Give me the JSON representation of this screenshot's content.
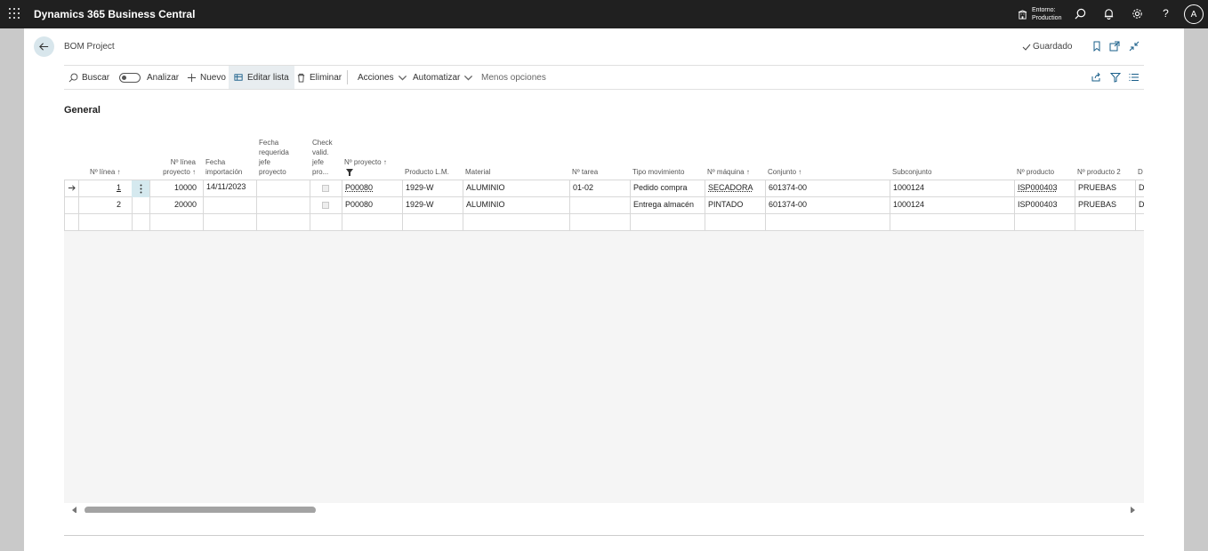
{
  "app": {
    "title": "Dynamics 365 Business Central",
    "env_label": "Entorno:",
    "env_value": "Production",
    "user_initial": "A"
  },
  "page": {
    "title": "BOM Project",
    "saved_label": "Guardado"
  },
  "actions": {
    "search": "Buscar",
    "analyze": "Analizar",
    "new": "Nuevo",
    "edit_list": "Editar lista",
    "delete": "Eliminar",
    "actions": "Acciones",
    "automate": "Automatizar",
    "fewer_options": "Menos opciones"
  },
  "section": {
    "title": "General"
  },
  "columns": {
    "line_no": "Nº línea",
    "line_no_project_1": "Nº línea",
    "line_no_project_2": "proyecto",
    "import_date_1": "Fecha",
    "import_date_2": "importación",
    "req_date_1": "Fecha",
    "req_date_2": "requerida",
    "req_date_3": "jefe",
    "req_date_4": "proyecto",
    "check_1": "Check",
    "check_2": "valid.",
    "check_3": "jefe",
    "check_4": "pro...",
    "project_no": "Nº proyecto",
    "bom_product": "Producto L.M.",
    "material": "Material",
    "task_no": "Nº tarea",
    "movement_type": "Tipo movimiento",
    "machine_no": "Nº máquina",
    "assembly": "Conjunto",
    "subassembly": "Subconjunto",
    "product_no": "Nº producto",
    "product_no_2": "Nº producto 2",
    "next_col": "D"
  },
  "rows": [
    {
      "line_no": "1",
      "line_no_project": "10000",
      "import_date": "14/11/2023",
      "req_date": "",
      "project_no": "P00080",
      "bom_product": "1929-W",
      "material": "ALUMINIO",
      "task_no": "01-02",
      "movement_type": "Pedido compra",
      "machine_no": "SECADORA",
      "assembly": "601374-00",
      "subassembly": "1000124",
      "product_no": "ISP000403",
      "product_no_2": "PRUEBAS",
      "next_col": "D"
    },
    {
      "line_no": "2",
      "line_no_project": "20000",
      "import_date": "",
      "req_date": "",
      "project_no": "P00080",
      "bom_product": "1929-W",
      "material": "ALUMINIO",
      "task_no": "",
      "movement_type": "Entrega almacén",
      "machine_no": "PINTADO",
      "assembly": "601374-00",
      "subassembly": "1000124",
      "product_no": "ISP000403",
      "product_no_2": "PRUEBAS",
      "next_col": "D"
    }
  ],
  "icons": {
    "waffle": "waffle-icon",
    "environment": "building-icon",
    "search": "search-icon",
    "bell": "bell-icon",
    "settings": "gear-icon",
    "help": "question-icon",
    "back": "back-arrow-icon",
    "bookmark": "bookmark-icon",
    "open_new": "open-new-window-icon",
    "collapse": "collapse-icon",
    "share": "share-icon",
    "filter": "filter-icon",
    "list": "list-icon"
  },
  "colors": {
    "topbar": "#202020",
    "accent_selection": "#d5e9ef",
    "edit_list_active": "#e8edf0"
  }
}
